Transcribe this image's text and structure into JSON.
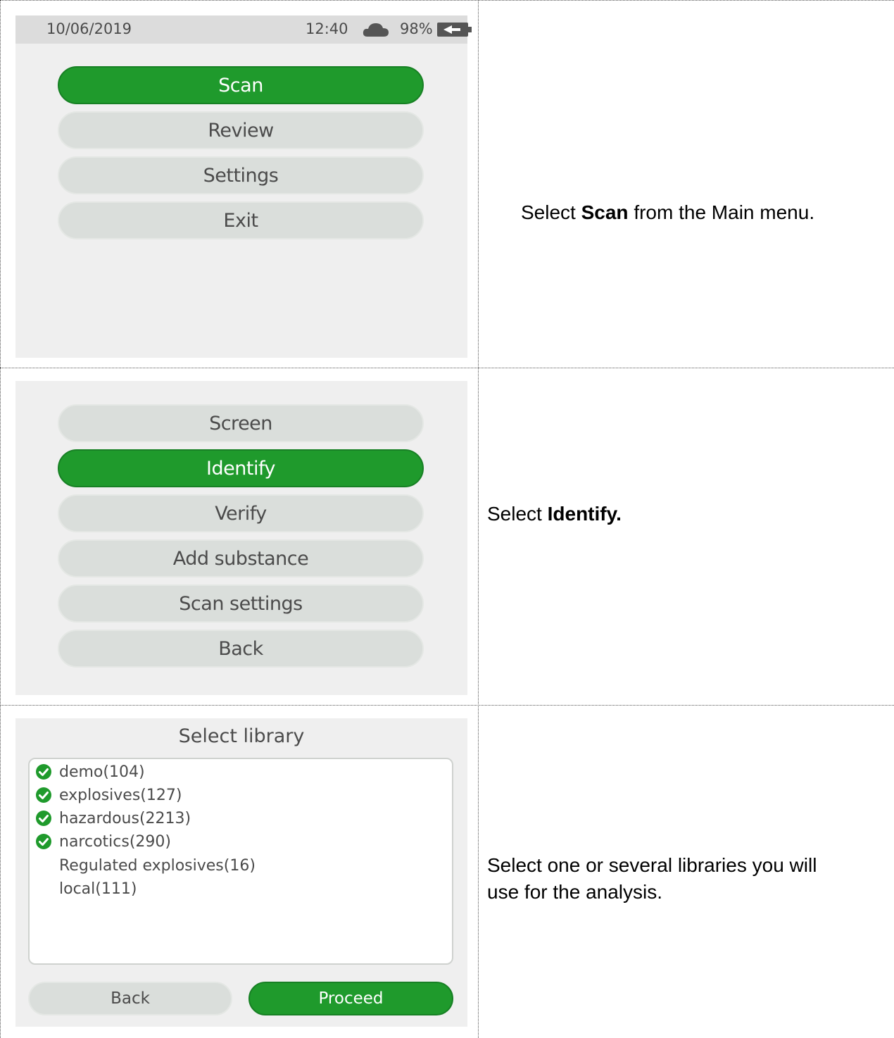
{
  "colors": {
    "accent_green": "#1f9a2c",
    "inactive_button": "#dadedb",
    "screen_bg": "#efefef"
  },
  "step1": {
    "status_bar": {
      "date": "10/06/2019",
      "time": "12:40",
      "battery": "98%",
      "cloud_icon": "cloud-icon",
      "battery_icon": "battery-charging-icon"
    },
    "menu": [
      {
        "label": "Scan",
        "selected": true
      },
      {
        "label": "Review",
        "selected": false
      },
      {
        "label": "Settings",
        "selected": false
      },
      {
        "label": "Exit",
        "selected": false
      }
    ],
    "instruction": {
      "prefix": "Select ",
      "bold": "Scan",
      "suffix": " from the Main menu."
    }
  },
  "step2": {
    "menu": [
      {
        "label": "Screen",
        "selected": false
      },
      {
        "label": "Identify",
        "selected": true
      },
      {
        "label": "Verify",
        "selected": false
      },
      {
        "label": "Add substance",
        "selected": false
      },
      {
        "label": "Scan settings",
        "selected": false
      },
      {
        "label": "Back",
        "selected": false
      }
    ],
    "instruction": {
      "prefix": "Select ",
      "bold": "Identify.",
      "suffix": ""
    }
  },
  "step3": {
    "title": "Select library",
    "libraries": [
      {
        "label": "demo(104)",
        "checked": true
      },
      {
        "label": "explosives(127)",
        "checked": true
      },
      {
        "label": "hazardous(2213)",
        "checked": true
      },
      {
        "label": "narcotics(290)",
        "checked": true
      },
      {
        "label": "Regulated explosives(16)",
        "checked": false
      },
      {
        "label": "local(111)",
        "checked": false
      }
    ],
    "back_label": "Back",
    "proceed_label": "Proceed",
    "instruction": {
      "line1": "Select one or several libraries you will",
      "line2": "use for the analysis."
    }
  }
}
